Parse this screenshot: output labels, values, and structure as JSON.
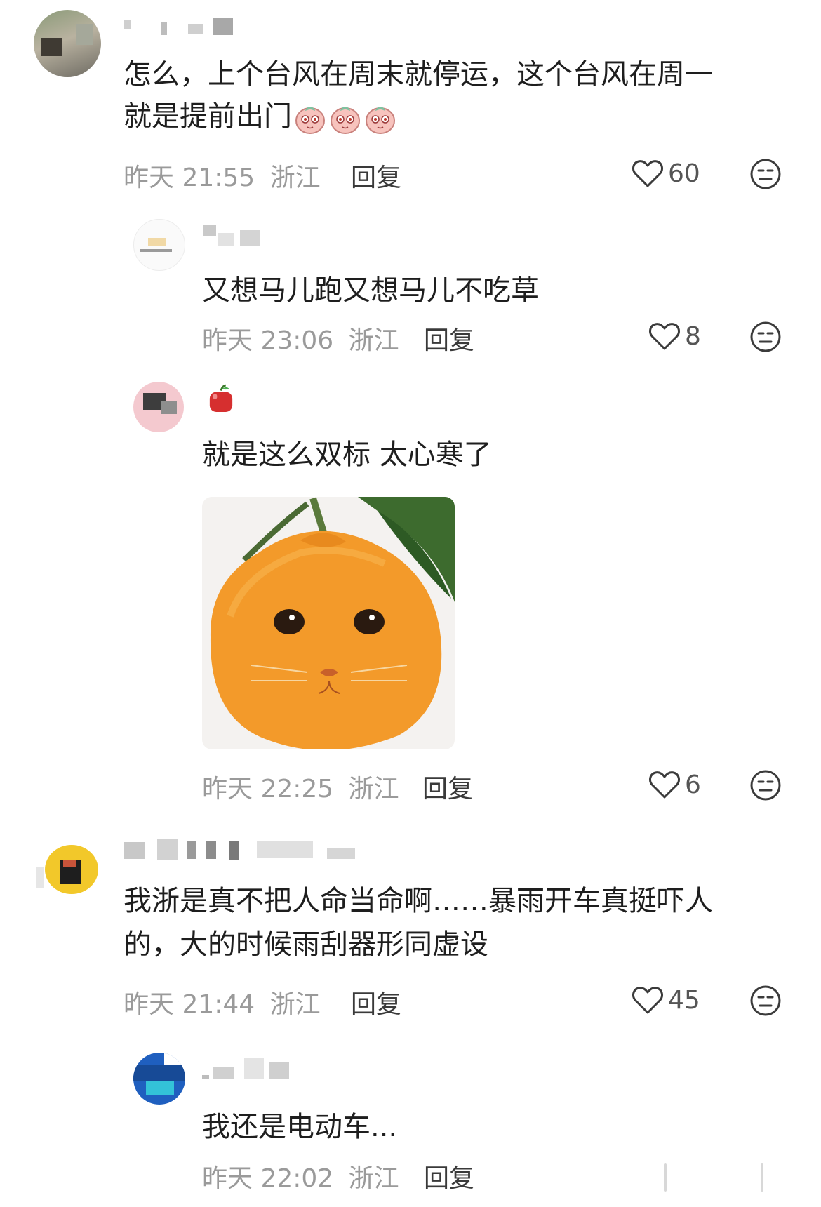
{
  "comments": [
    {
      "text_line1": "怎么，上个台风在周末就停运，这个台风在周一",
      "text_line2": "就是提前出门",
      "emoji_icon": "peach-face-emoji",
      "time": "昨天 21:55",
      "location": "浙江",
      "reply_label": "回复",
      "likes": "60",
      "replies": [
        {
          "text": "又想马儿跑又想马儿不吃草",
          "time": "昨天 23:06",
          "location": "浙江",
          "reply_label": "回复",
          "likes": "8"
        },
        {
          "text": "就是这么双标 太心寒了",
          "time": "昨天 22:25",
          "location": "浙江",
          "reply_label": "回复",
          "likes": "6",
          "nickname_icon": "red-apple-emoji",
          "image_icon": "orange-cat-meme-image"
        }
      ]
    },
    {
      "text_line1": "我浙是真不把人命当命啊……暴雨开车真挺吓人",
      "text_line2": "的，大的时候雨刮器形同虚设",
      "time": "昨天 21:44",
      "location": "浙江",
      "reply_label": "回复",
      "likes": "45",
      "replies": [
        {
          "text": "我还是电动车...",
          "time": "昨天 22:02",
          "location": "浙江",
          "reply_label": "回复"
        }
      ]
    }
  ],
  "icons": {
    "like": "heart-outline-icon",
    "reaction": "neutral-face-icon"
  },
  "colors": {
    "meta_text": "#9a9a9a",
    "orange": "#f39a2a"
  }
}
